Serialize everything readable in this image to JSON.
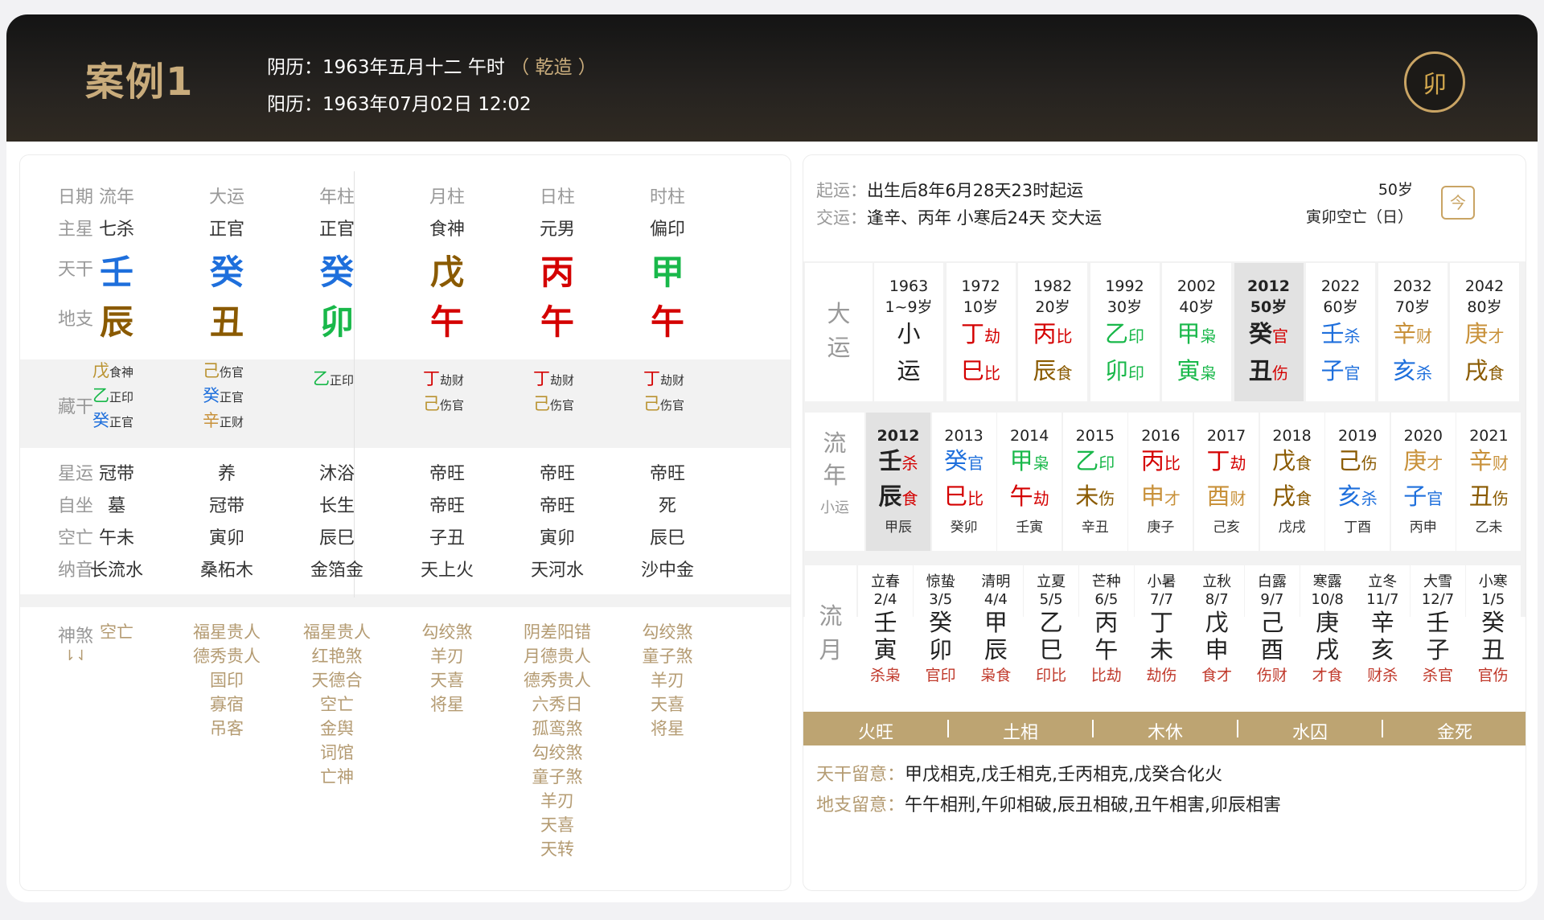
{
  "header": {
    "title": "案例1",
    "lunar_label": "阴历：",
    "lunar_value": "1963年五月十二 午时",
    "gender": "（ 乾造 ）",
    "solar_label": "阳历：",
    "solar_value": "1963年07月02日 12:02",
    "logo_text": "卯"
  },
  "left": {
    "row_labels": {
      "date": "日期",
      "zhuxing": "主星",
      "tiangan": "天干",
      "dizhi": "地支",
      "canggan": "藏干",
      "xingyun": "星运",
      "zizuo": "自坐",
      "kongwang": "空亡",
      "nayin": "纳音",
      "shensha": "神煞",
      "shensha_icon": "⇂⇃"
    },
    "columns": [
      {
        "head": "流年",
        "zhuxing": "七杀",
        "tg": "壬",
        "tg_color": "#1e6fdc",
        "dz": "辰",
        "dz_color": "#8a5a00",
        "canggan": [
          {
            "c": "戊",
            "t": "食神",
            "color": "#b9922f"
          },
          {
            "c": "乙",
            "t": "正印",
            "color": "#19b84a"
          },
          {
            "c": "癸",
            "t": "正官",
            "color": "#1e6fdc"
          }
        ],
        "xingyun": "冠带",
        "zizuo": "墓",
        "kongwang": "午未",
        "nayin": "长流水",
        "shensha": [
          "空亡"
        ]
      },
      {
        "head": "大运",
        "zhuxing": "正官",
        "tg": "癸",
        "tg_color": "#1e6fdc",
        "dz": "丑",
        "dz_color": "#8a5a00",
        "canggan": [
          {
            "c": "己",
            "t": "伤官",
            "color": "#b9922f"
          },
          {
            "c": "癸",
            "t": "正官",
            "color": "#1e6fdc"
          },
          {
            "c": "辛",
            "t": "正财",
            "color": "#c8913a"
          }
        ],
        "xingyun": "养",
        "zizuo": "冠带",
        "kongwang": "寅卯",
        "nayin": "桑柘木",
        "shensha": [
          "福星贵人",
          "德秀贵人",
          "国印",
          "寡宿",
          "吊客"
        ]
      },
      {
        "head": "年柱",
        "zhuxing": "正官",
        "tg": "癸",
        "tg_color": "#1e6fdc",
        "dz": "卯",
        "dz_color": "#19b84a",
        "canggan": [
          {
            "c": "乙",
            "t": "正印",
            "color": "#19b84a"
          }
        ],
        "xingyun": "沐浴",
        "zizuo": "长生",
        "kongwang": "辰巳",
        "nayin": "金箔金",
        "shensha": [
          "福星贵人",
          "红艳煞",
          "天德合",
          "空亡",
          "金舆",
          "词馆",
          "亡神"
        ]
      },
      {
        "head": "月柱",
        "zhuxing": "食神",
        "tg": "戊",
        "tg_color": "#8a5a00",
        "dz": "午",
        "dz_color": "#d40000",
        "canggan": [
          {
            "c": "丁",
            "t": "劫财",
            "color": "#d40000"
          },
          {
            "c": "己",
            "t": "伤官",
            "color": "#b9922f"
          }
        ],
        "xingyun": "帝旺",
        "zizuo": "帝旺",
        "kongwang": "子丑",
        "nayin": "天上火",
        "shensha": [
          "勾绞煞",
          "羊刃",
          "天喜",
          "将星"
        ]
      },
      {
        "head": "日柱",
        "zhuxing": "元男",
        "tg": "丙",
        "tg_color": "#d40000",
        "dz": "午",
        "dz_color": "#d40000",
        "canggan": [
          {
            "c": "丁",
            "t": "劫财",
            "color": "#d40000"
          },
          {
            "c": "己",
            "t": "伤官",
            "color": "#b9922f"
          }
        ],
        "xingyun": "帝旺",
        "zizuo": "帝旺",
        "kongwang": "寅卯",
        "nayin": "天河水",
        "shensha": [
          "阴差阳错",
          "月德贵人",
          "德秀贵人",
          "六秀日",
          "孤鸾煞",
          "勾绞煞",
          "童子煞",
          "羊刃",
          "天喜",
          "天转"
        ]
      },
      {
        "head": "时柱",
        "zhuxing": "偏印",
        "tg": "甲",
        "tg_color": "#19b84a",
        "dz": "午",
        "dz_color": "#d40000",
        "canggan": [
          {
            "c": "丁",
            "t": "劫财",
            "color": "#d40000"
          },
          {
            "c": "己",
            "t": "伤官",
            "color": "#b9922f"
          }
        ],
        "xingyun": "帝旺",
        "zizuo": "死",
        "kongwang": "辰巳",
        "nayin": "沙中金",
        "shensha": [
          "勾绞煞",
          "童子煞",
          "羊刃",
          "天喜",
          "将星"
        ]
      }
    ]
  },
  "right": {
    "qiyun_label": "起运：",
    "qiyun": "出生后8年6月28天23时起运",
    "jiaoyun_label": "交运：",
    "jiaoyun": "逢辛、丙年 小寒后24天 交大运",
    "age": "50岁",
    "kongwang": "寅卯空亡（日）",
    "cal_icon": "今",
    "dayun_label": [
      "大",
      "运"
    ],
    "dayun": [
      {
        "y": "1963",
        "a": "1~9岁",
        "g": "小",
        "gs": "",
        "z": "运",
        "zs": "",
        "gc": "#222",
        "zc": "#222"
      },
      {
        "y": "1972",
        "a": "10岁",
        "g": "丁",
        "gs": "劫",
        "z": "巳",
        "zs": "比",
        "gc": "#d40000",
        "zc": "#d40000"
      },
      {
        "y": "1982",
        "a": "20岁",
        "g": "丙",
        "gs": "比",
        "z": "辰",
        "zs": "食",
        "gc": "#d40000",
        "zc": "#8a5a00"
      },
      {
        "y": "1992",
        "a": "30岁",
        "g": "乙",
        "gs": "印",
        "z": "卯",
        "zs": "印",
        "gc": "#19b84a",
        "zc": "#19b84a"
      },
      {
        "y": "2002",
        "a": "40岁",
        "g": "甲",
        "gs": "枭",
        "z": "寅",
        "zs": "枭",
        "gc": "#19b84a",
        "zc": "#19b84a"
      },
      {
        "y": "2012",
        "a": "50岁",
        "g": "癸",
        "gs": "官",
        "z": "丑",
        "zs": "伤",
        "gc": "#1e6fdc",
        "zc": "#8a5a00"
      },
      {
        "y": "2022",
        "a": "60岁",
        "g": "壬",
        "gs": "杀",
        "z": "子",
        "zs": "官",
        "gc": "#1e6fdc",
        "zc": "#1e6fdc"
      },
      {
        "y": "2032",
        "a": "70岁",
        "g": "辛",
        "gs": "财",
        "z": "亥",
        "zs": "杀",
        "gc": "#c8913a",
        "zc": "#1e6fdc"
      },
      {
        "y": "2042",
        "a": "80岁",
        "g": "庚",
        "gs": "才",
        "z": "戌",
        "zs": "食",
        "gc": "#c8913a",
        "zc": "#8a5a00"
      }
    ],
    "liunian_label": [
      "流",
      "年"
    ],
    "xiaoyun_label": "小运",
    "liunian": [
      {
        "y": "2012",
        "g": "壬",
        "gs": "杀",
        "z": "辰",
        "zs": "食",
        "h": "甲辰"
      },
      {
        "y": "2013",
        "g": "癸",
        "gs": "官",
        "z": "巳",
        "zs": "比",
        "h": "癸卯"
      },
      {
        "y": "2014",
        "g": "甲",
        "gs": "枭",
        "z": "午",
        "zs": "劫",
        "h": "壬寅"
      },
      {
        "y": "2015",
        "g": "乙",
        "gs": "印",
        "z": "未",
        "zs": "伤",
        "h": "辛丑"
      },
      {
        "y": "2016",
        "g": "丙",
        "gs": "比",
        "z": "申",
        "zs": "才",
        "h": "庚子"
      },
      {
        "y": "2017",
        "g": "丁",
        "gs": "劫",
        "z": "酉",
        "zs": "财",
        "h": "己亥"
      },
      {
        "y": "2018",
        "g": "戊",
        "gs": "食",
        "z": "戌",
        "zs": "食",
        "h": "戊戌"
      },
      {
        "y": "2019",
        "g": "己",
        "gs": "伤",
        "z": "亥",
        "zs": "杀",
        "h": "丁酉"
      },
      {
        "y": "2020",
        "g": "庚",
        "gs": "才",
        "z": "子",
        "zs": "官",
        "h": "丙申"
      },
      {
        "y": "2021",
        "g": "辛",
        "gs": "财",
        "z": "丑",
        "zs": "伤",
        "h": "乙未"
      }
    ],
    "liuyue_label": [
      "流",
      "月"
    ],
    "liuyue": [
      {
        "jq": "立春",
        "d": "2/4",
        "g": "壬",
        "z": "寅",
        "s": "杀枭"
      },
      {
        "jq": "惊蛰",
        "d": "3/5",
        "g": "癸",
        "z": "卯",
        "s": "官印"
      },
      {
        "jq": "清明",
        "d": "4/4",
        "g": "甲",
        "z": "辰",
        "s": "枭食"
      },
      {
        "jq": "立夏",
        "d": "5/5",
        "g": "乙",
        "z": "巳",
        "s": "印比"
      },
      {
        "jq": "芒种",
        "d": "6/5",
        "g": "丙",
        "z": "午",
        "s": "比劫"
      },
      {
        "jq": "小暑",
        "d": "7/7",
        "g": "丁",
        "z": "未",
        "s": "劫伤"
      },
      {
        "jq": "立秋",
        "d": "8/7",
        "g": "戊",
        "z": "申",
        "s": "食才"
      },
      {
        "jq": "白露",
        "d": "9/7",
        "g": "己",
        "z": "酉",
        "s": "伤财"
      },
      {
        "jq": "寒露",
        "d": "10/8",
        "g": "庚",
        "z": "戌",
        "s": "才食"
      },
      {
        "jq": "立冬",
        "d": "11/7",
        "g": "辛",
        "z": "亥",
        "s": "财杀"
      },
      {
        "jq": "大雪",
        "d": "12/7",
        "g": "壬",
        "z": "子",
        "s": "杀官"
      },
      {
        "jq": "小寒",
        "d": "1/5",
        "g": "癸",
        "z": "丑",
        "s": "官伤"
      }
    ],
    "wuxing": [
      "火旺",
      "土相",
      "木休",
      "水囚",
      "金死"
    ],
    "tg_note_label": "天干留意：",
    "tg_note": "甲戊相克,戊壬相克,壬丙相克,戊癸合化火",
    "dz_note_label": "地支留意：",
    "dz_note": "午午相刑,午卯相破,辰丑相破,丑午相害,卯辰相害"
  },
  "colors": {
    "gold": "#c9ac7c",
    "bar": "#bda472",
    "fire": "#d40000",
    "water": "#1e6fdc",
    "wood": "#19b84a",
    "earth": "#8a5a00"
  }
}
